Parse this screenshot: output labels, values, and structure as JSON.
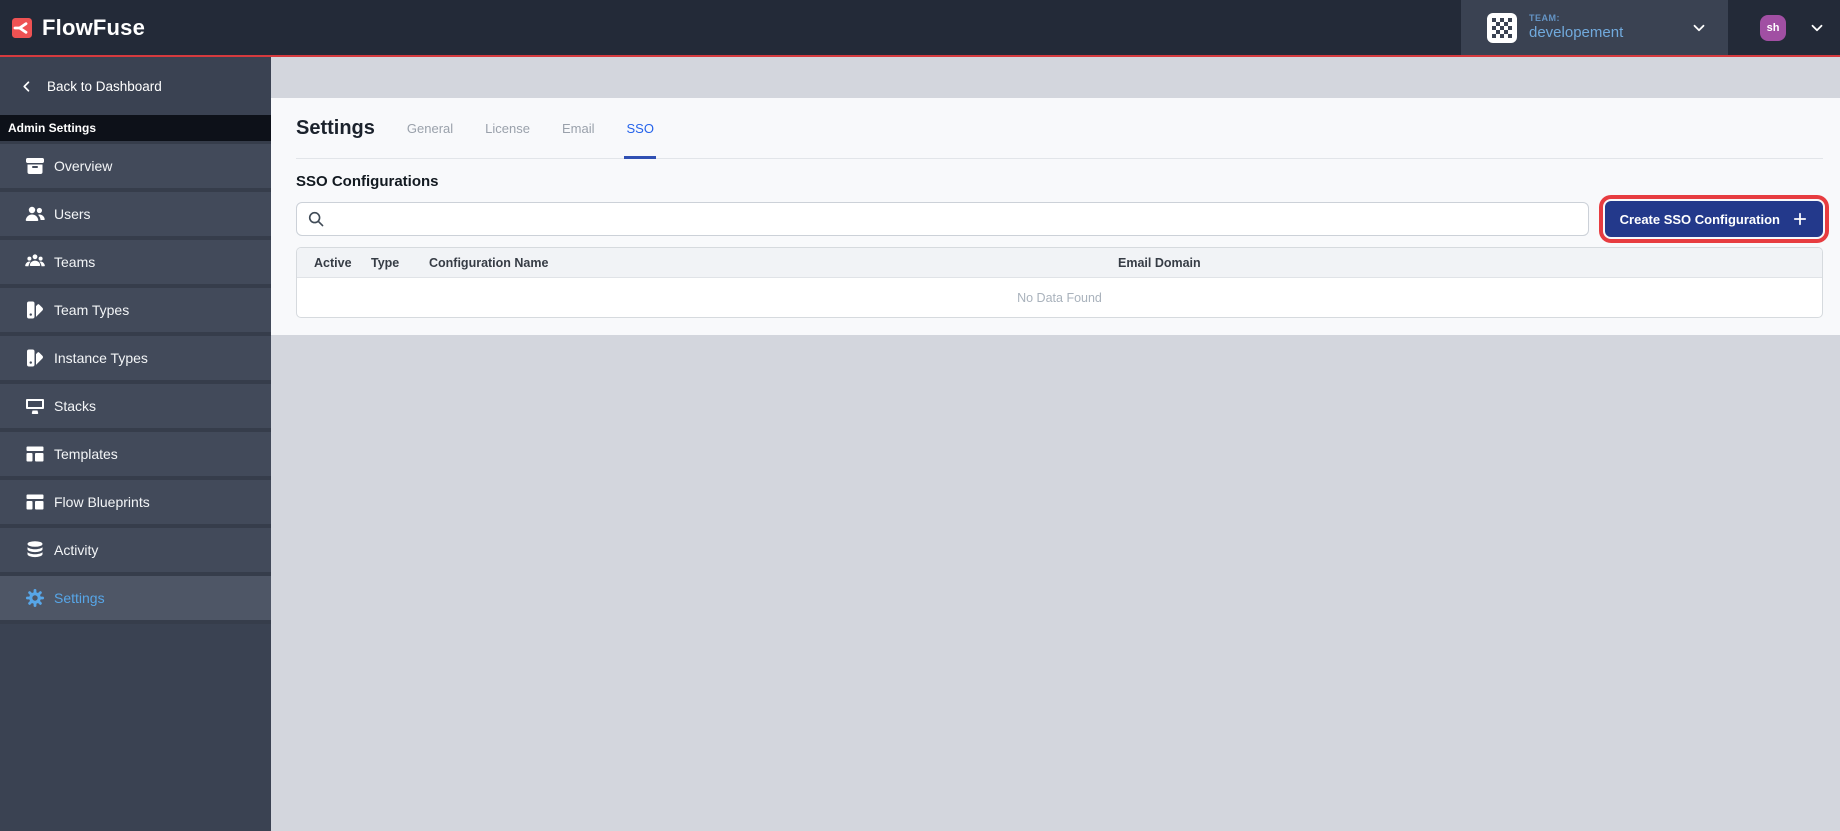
{
  "navbar": {
    "brand": "FlowFuse",
    "team": {
      "label": "TEAM:",
      "name": "developement"
    },
    "user": {
      "initials": "sh"
    }
  },
  "sidebar": {
    "back": "Back to Dashboard",
    "section": "Admin Settings",
    "items": [
      {
        "label": "Overview",
        "icon": "overview-icon",
        "active": false
      },
      {
        "label": "Users",
        "icon": "users-icon",
        "active": false
      },
      {
        "label": "Teams",
        "icon": "teams-icon",
        "active": false
      },
      {
        "label": "Team Types",
        "icon": "team-types-icon",
        "active": false
      },
      {
        "label": "Instance Types",
        "icon": "instance-types-icon",
        "active": false
      },
      {
        "label": "Stacks",
        "icon": "stacks-icon",
        "active": false
      },
      {
        "label": "Templates",
        "icon": "templates-icon",
        "active": false
      },
      {
        "label": "Flow Blueprints",
        "icon": "flow-blueprints-icon",
        "active": false
      },
      {
        "label": "Activity",
        "icon": "activity-icon",
        "active": false
      },
      {
        "label": "Settings",
        "icon": "settings-gear-icon",
        "active": true
      }
    ]
  },
  "main": {
    "title": "Settings",
    "tabs": [
      {
        "label": "General",
        "active": false
      },
      {
        "label": "License",
        "active": false
      },
      {
        "label": "Email",
        "active": false
      },
      {
        "label": "SSO",
        "active": true
      }
    ],
    "section_title": "SSO Configurations",
    "search": {
      "value": "",
      "placeholder": ""
    },
    "create_button": "Create SSO Configuration",
    "table": {
      "columns": [
        "Active",
        "Type",
        "Configuration Name",
        "Email Domain"
      ],
      "empty": "No Data Found"
    }
  },
  "colors": {
    "brand_red": "#ee5253",
    "navbar_accent_line": "#d63a3e",
    "active_tab_blue": "#2563eb",
    "sidebar_active_blue": "#57a6e8",
    "create_button_navy": "#23398b",
    "annotation_red": "#e73c40",
    "avatar_purple": "#a14fa3",
    "team_text_blue": "#71aadd"
  }
}
